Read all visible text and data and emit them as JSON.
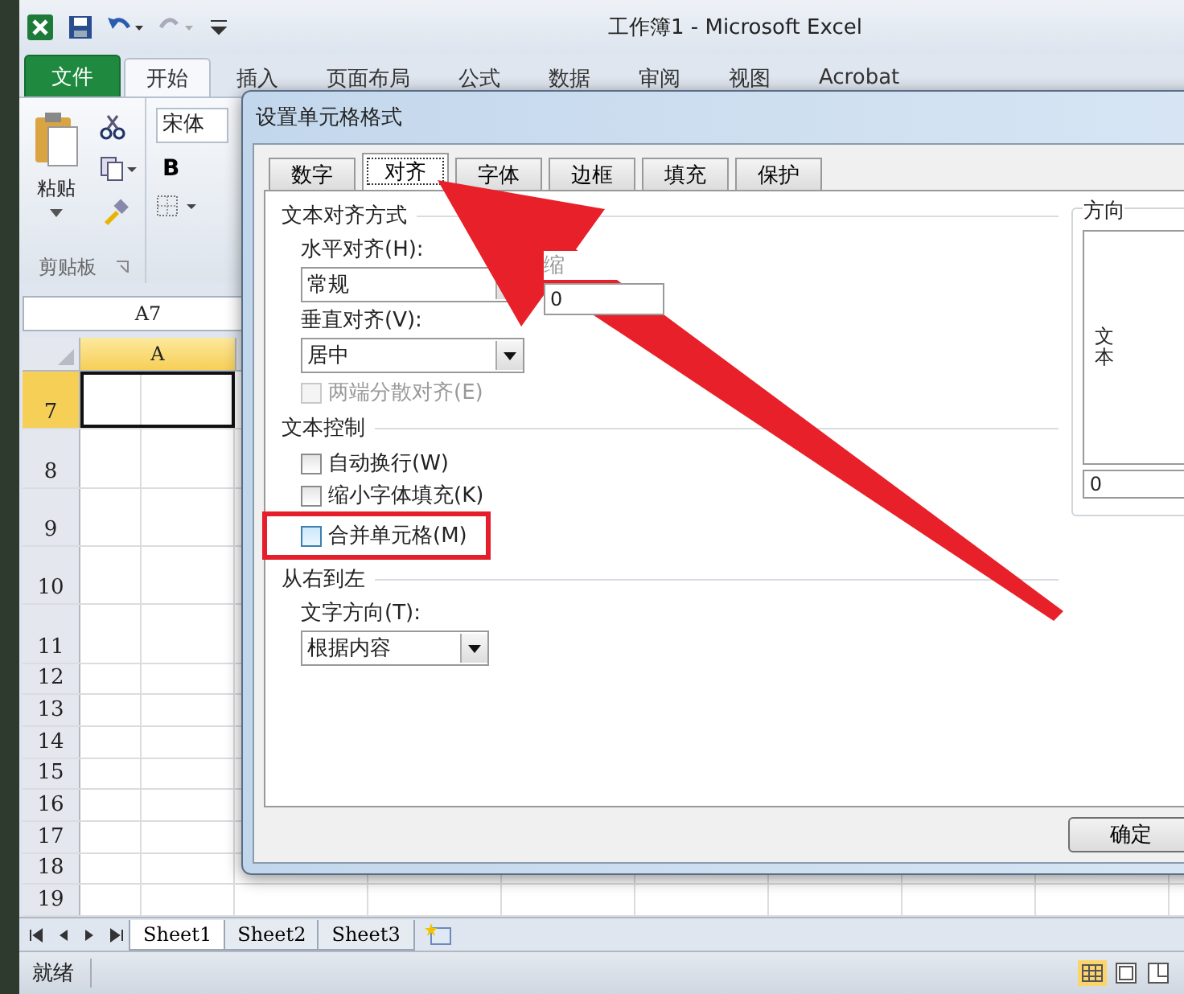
{
  "window": {
    "title": "工作簿1 - Microsoft Excel"
  },
  "ribbon_tabs": [
    {
      "label": "文件",
      "kind": "file",
      "selected": false
    },
    {
      "label": "开始",
      "kind": "tab",
      "selected": true
    },
    {
      "label": "插入",
      "kind": "tab",
      "selected": false
    },
    {
      "label": "页面布局",
      "kind": "tab",
      "selected": false
    },
    {
      "label": "公式",
      "kind": "tab",
      "selected": false
    },
    {
      "label": "数据",
      "kind": "tab",
      "selected": false
    },
    {
      "label": "审阅",
      "kind": "tab",
      "selected": false
    },
    {
      "label": "视图",
      "kind": "tab",
      "selected": false
    },
    {
      "label": "Acrobat",
      "kind": "tab",
      "selected": false
    }
  ],
  "clipboard": {
    "paste": "粘贴",
    "group": "剪贴板"
  },
  "font": {
    "name": "宋体",
    "bold": "B"
  },
  "name_box": "A7",
  "grid": {
    "column": "A",
    "rows": [
      {
        "label": "7",
        "kind": "tall",
        "selected": true
      },
      {
        "label": "8",
        "kind": "tall",
        "selected": false
      },
      {
        "label": "9",
        "kind": "tall",
        "selected": false
      },
      {
        "label": "10",
        "kind": "tall",
        "selected": false
      },
      {
        "label": "11",
        "kind": "tall",
        "selected": false
      },
      {
        "label": "12",
        "kind": "normal",
        "selected": false
      },
      {
        "label": "13",
        "kind": "normal",
        "selected": false
      },
      {
        "label": "14",
        "kind": "normal",
        "selected": false
      },
      {
        "label": "15",
        "kind": "normal",
        "selected": false
      },
      {
        "label": "16",
        "kind": "normal",
        "selected": false
      },
      {
        "label": "17",
        "kind": "normal",
        "selected": false
      },
      {
        "label": "18",
        "kind": "normal",
        "selected": false
      },
      {
        "label": "19",
        "kind": "normal",
        "selected": false
      }
    ]
  },
  "sheet_tabs": [
    {
      "label": "Sheet1",
      "selected": true
    },
    {
      "label": "Sheet2",
      "selected": false
    },
    {
      "label": "Sheet3",
      "selected": false
    }
  ],
  "status_bar": {
    "text": "就绪"
  },
  "dialog": {
    "title": "设置单元格格式",
    "tabs": [
      {
        "label": "数字",
        "selected": false
      },
      {
        "label": "对齐",
        "selected": true
      },
      {
        "label": "字体",
        "selected": false
      },
      {
        "label": "边框",
        "selected": false
      },
      {
        "label": "填充",
        "selected": false
      },
      {
        "label": "保护",
        "selected": false
      }
    ],
    "alignment": {
      "heading": "文本对齐方式",
      "horizontal_label": "水平对齐(H):",
      "horizontal_value": "常规",
      "indent_label": "缩",
      "indent_value": "0",
      "vertical_label": "垂直对齐(V):",
      "vertical_value": "居中",
      "distributed": {
        "label": "两端分散对齐(E)",
        "checked": false,
        "disabled": true
      }
    },
    "text_control": {
      "heading": "文本控制",
      "options": [
        {
          "label": "自动换行(W)",
          "checked": false,
          "hover": false,
          "annotated": false
        },
        {
          "label": "缩小字体填充(K)",
          "checked": false,
          "hover": false,
          "annotated": false
        },
        {
          "label": "合并单元格(M)",
          "checked": false,
          "hover": true,
          "annotated": true
        }
      ]
    },
    "rtl": {
      "heading": "从右到左",
      "direction_label": "文字方向(T):",
      "direction_value": "根据内容"
    },
    "orientation": {
      "heading": "方向",
      "vertical_text": "文本",
      "degrees": "0"
    },
    "ok_button": "确定"
  }
}
